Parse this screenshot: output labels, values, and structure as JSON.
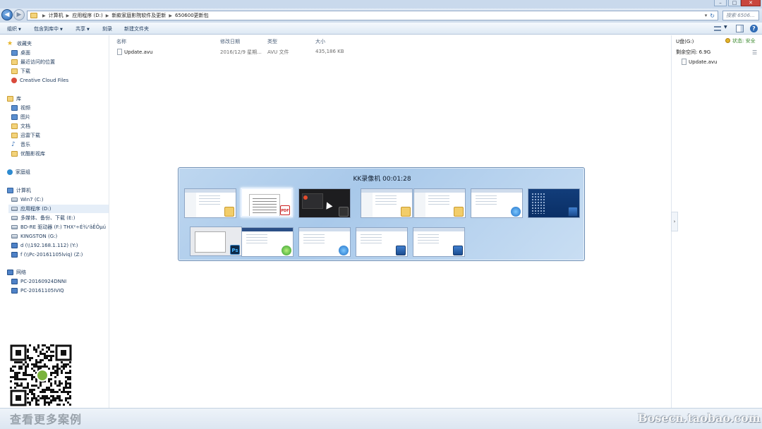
{
  "window": {
    "controls": [
      "–",
      "□",
      "✕"
    ]
  },
  "address": {
    "breadcrumbs": [
      "计算机",
      "应用程序 (D:)",
      "新款家庭影院软件及更新",
      "650600更新包"
    ],
    "search_placeholder": "搜索 6506..."
  },
  "toolbar": {
    "organize": "组织",
    "include_in_library": "包含到库中",
    "share": "共享",
    "burn": "刻录",
    "new_folder": "新建文件夹"
  },
  "sidebar": {
    "favorites": {
      "label": "收藏夹",
      "items": [
        "桌面",
        "最近访问的位置",
        "下载",
        "Creative Cloud Files"
      ]
    },
    "libraries": {
      "label": "库",
      "items": [
        "视频",
        "图片",
        "文档",
        "迅雷下载",
        "音乐",
        "优酷影视库"
      ]
    },
    "homegroup": {
      "label": "家庭组"
    },
    "computer": {
      "label": "计算机",
      "items": [
        "Win7 (C:)",
        "应用程序 (D:)",
        "多媒体、备份、下载 (E:)",
        "BD-RE 驱动器 (F:) THX²÷É¾²âÊÔµú",
        "KINGSTON (G:)",
        "d (\\\\192.168.1.112) (Y:)",
        "f (\\\\Pc-20161105lviq) (Z:)"
      ],
      "selected_index": 1
    },
    "network": {
      "label": "网络",
      "items": [
        "PC-20160924DNNI",
        "PC-20161105IVIQ"
      ]
    }
  },
  "filelist": {
    "columns": {
      "name": "名称",
      "modified": "修改日期",
      "type": "类型",
      "size": "大小"
    },
    "rows": [
      {
        "name": "Update.avu",
        "modified": "2016/12/9 星期...",
        "type": "AVU 文件",
        "size": "435,186 KB"
      }
    ]
  },
  "preview": {
    "drive": "U盘(G:)",
    "free_space": "剩余空间: 6.9G",
    "status": "状态: 安全",
    "file": "Update.avu"
  },
  "switcher": {
    "title": "KK录像机 00:01:28",
    "selected_index": 1
  },
  "footer": {
    "promo": "查看更多案例",
    "watermark": "Bosecn.taobao.com"
  },
  "colors": {
    "accent": "#1e395b",
    "switcher_bg": "#a1c4e8",
    "status_ok": "#3c8a2f"
  }
}
